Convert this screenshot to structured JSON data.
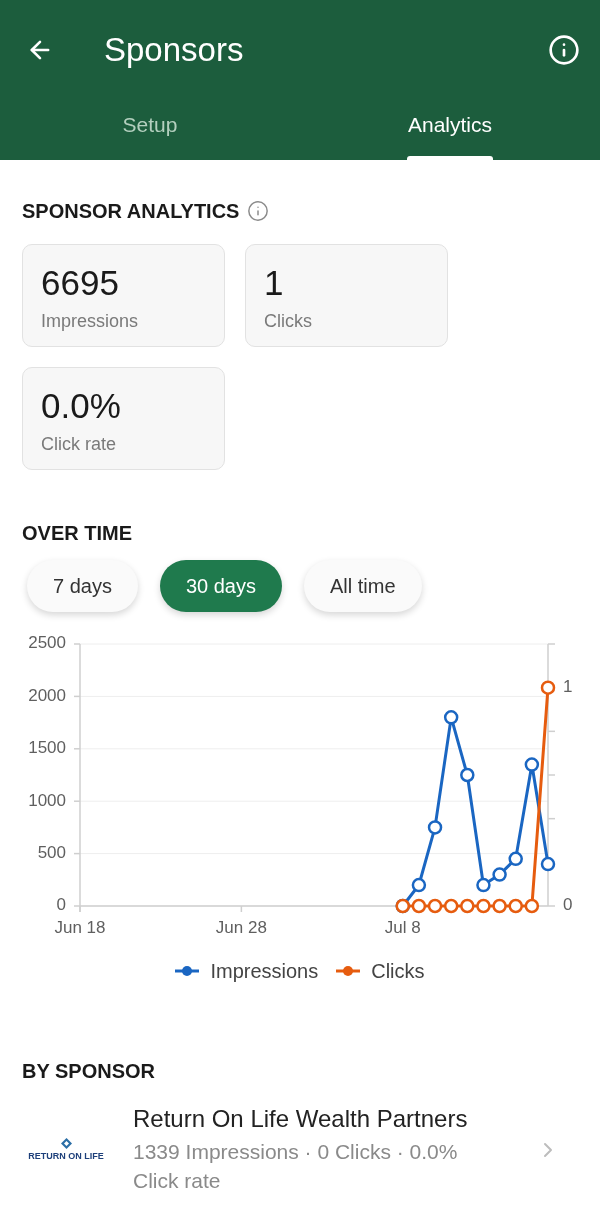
{
  "header": {
    "title": "Sponsors"
  },
  "tabs": [
    {
      "label": "Setup",
      "selected": false
    },
    {
      "label": "Analytics",
      "selected": true
    }
  ],
  "summary": {
    "title": "SPONSOR ANALYTICS",
    "stats": [
      {
        "value": "6695",
        "label": "Impressions"
      },
      {
        "value": "1",
        "label": "Clicks"
      },
      {
        "value": "0.0%",
        "label": "Click rate"
      }
    ]
  },
  "over_time": {
    "title": "OVER TIME",
    "ranges": [
      {
        "label": "7 days",
        "selected": false
      },
      {
        "label": "30 days",
        "selected": true
      },
      {
        "label": "All time",
        "selected": false
      }
    ],
    "chart_data": {
      "type": "line",
      "grid": true,
      "categories": [
        "Jun 18",
        null,
        null,
        null,
        null,
        null,
        null,
        null,
        null,
        null,
        "Jun 28",
        null,
        null,
        null,
        null,
        null,
        null,
        null,
        null,
        null,
        "Jul 8",
        null,
        null,
        null,
        null,
        null,
        null,
        null,
        null,
        null
      ],
      "ylim": [
        0,
        2500
      ],
      "yticks": [
        0,
        500,
        1000,
        1500,
        2000,
        2500
      ],
      "y2lim": [
        0,
        1.2
      ],
      "y2ticks": [
        0,
        1
      ],
      "series": [
        {
          "name": "Impressions",
          "color": "#1a66c2",
          "marker": "circle",
          "values": [
            null,
            null,
            null,
            null,
            null,
            null,
            null,
            null,
            null,
            null,
            null,
            null,
            null,
            null,
            null,
            null,
            null,
            null,
            null,
            null,
            0,
            200,
            750,
            1800,
            1250,
            200,
            300,
            450,
            1350,
            400
          ]
        },
        {
          "name": "Clicks",
          "color": "#e65c0f",
          "axis": "y2",
          "marker": "circle",
          "values": [
            null,
            null,
            null,
            null,
            null,
            null,
            null,
            null,
            null,
            null,
            null,
            null,
            null,
            null,
            null,
            null,
            null,
            null,
            null,
            null,
            0,
            0,
            0,
            0,
            0,
            0,
            0,
            0,
            0,
            1
          ]
        }
      ]
    }
  },
  "by_sponsor": {
    "title": "BY SPONSOR",
    "sponsors": [
      {
        "logo_text": "RETURN ON LIFE",
        "name": "Return On Life Wealth Partners",
        "stats": "1339 Impressions · 0 Clicks · 0.0% Click rate"
      }
    ]
  }
}
